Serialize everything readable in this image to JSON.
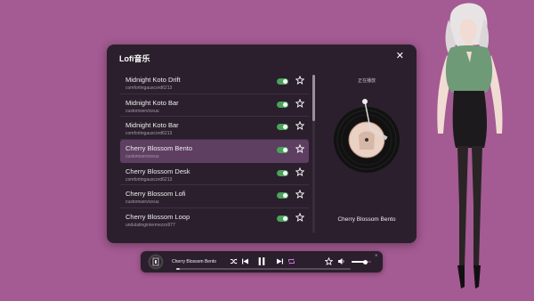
{
  "panel": {
    "title": "Lofi音乐",
    "close_icon": "close-icon"
  },
  "songs": [
    {
      "title": "Midnight Koto Drift",
      "artist": "comfortingauxcord6213",
      "enabled": true,
      "active": false
    },
    {
      "title": "Midnight Koto Bar",
      "artist": "customserviceuu",
      "enabled": true,
      "active": false
    },
    {
      "title": "Midnight Koto Bar",
      "artist": "comfortingauxcord6213",
      "enabled": true,
      "active": false
    },
    {
      "title": "Cherry Blossom Bento",
      "artist": "customserviceuu",
      "enabled": true,
      "active": true
    },
    {
      "title": "Cherry Blossom Desk",
      "artist": "comfortingauxcord6213",
      "enabled": true,
      "active": false
    },
    {
      "title": "Cherry Blossom Lofi",
      "artist": "customserviceuu",
      "enabled": true,
      "active": false
    },
    {
      "title": "Cherry Blossom Loop",
      "artist": "undulatingintermezzo977",
      "enabled": true,
      "active": false
    }
  ],
  "now_playing": {
    "label": "正在播放",
    "title": "Cherry Blossom Bento"
  },
  "player": {
    "title": "Cherry Blossom Bento",
    "progress": 0.02,
    "volume": 0.7
  },
  "colors": {
    "background": "#a45a92",
    "panel": "#2b1f2d",
    "active_row": "#5e3f62",
    "toggle_on": "#4aa35a"
  }
}
